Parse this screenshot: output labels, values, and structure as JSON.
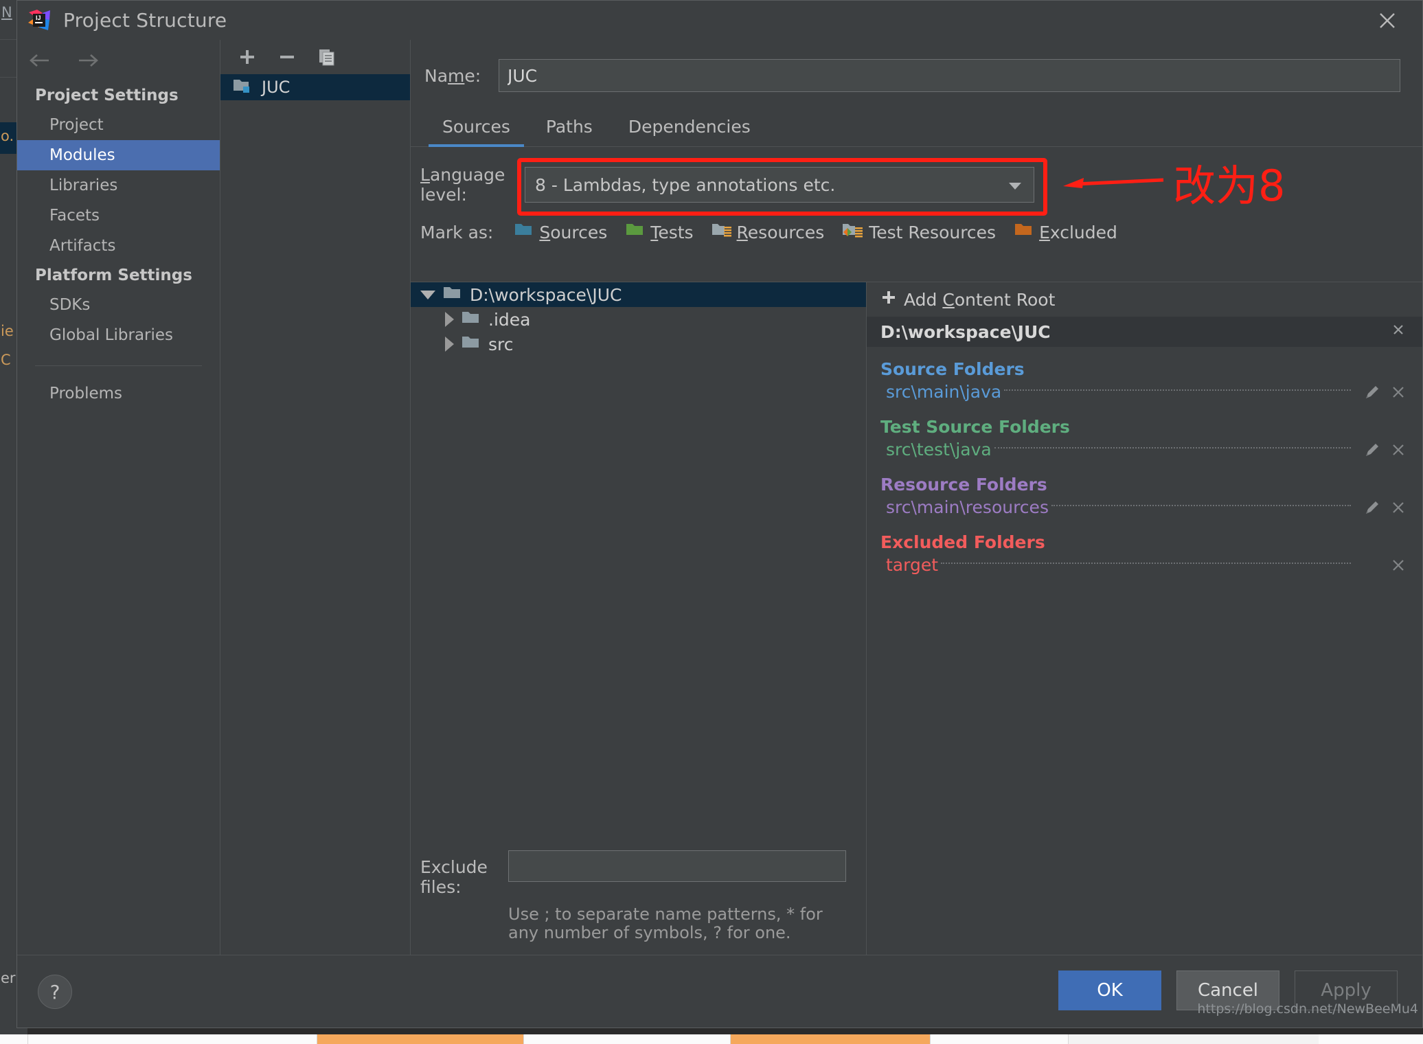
{
  "window": {
    "title": "Project Structure",
    "logo_icon": "intellij-idea-logo-icon",
    "close_icon": "close-icon"
  },
  "background": {
    "left_fragments": [
      "N",
      "o.",
      "ie",
      "C",
      "er"
    ],
    "watermark": "https://blog.csdn.net/NewBeeMu4"
  },
  "nav": {
    "back_icon": "arrow-left-icon",
    "forward_icon": "arrow-right-icon",
    "groups": [
      {
        "title": "Project Settings",
        "items": [
          {
            "label": "Project",
            "selected": false
          },
          {
            "label": "Modules",
            "selected": true
          },
          {
            "label": "Libraries",
            "selected": false
          },
          {
            "label": "Facets",
            "selected": false
          },
          {
            "label": "Artifacts",
            "selected": false
          }
        ]
      },
      {
        "title": "Platform Settings",
        "items": [
          {
            "label": "SDKs",
            "selected": false
          },
          {
            "label": "Global Libraries",
            "selected": false
          }
        ]
      }
    ],
    "footer_item": "Problems"
  },
  "module_list": {
    "toolbar": [
      {
        "icon": "plus-icon",
        "name": "add-module-button"
      },
      {
        "icon": "minus-icon",
        "name": "remove-module-button"
      },
      {
        "icon": "copy-icon",
        "name": "copy-module-button"
      }
    ],
    "modules": [
      {
        "label": "JUC",
        "icon": "module-folder-icon",
        "selected": true
      }
    ]
  },
  "main": {
    "name_label": "Name:",
    "name_label_mnemonic": "m",
    "name_value": "JUC",
    "name_placeholder": "",
    "tabs": [
      {
        "label": "Sources",
        "active": true
      },
      {
        "label": "Paths",
        "active": false
      },
      {
        "label": "Dependencies",
        "active": false
      }
    ],
    "language_level": {
      "label": "Language level:",
      "label_mnemonic": "L",
      "value": "8 - Lambdas, type annotations etc.",
      "dropdown_icon": "chevron-down-icon",
      "highlighted": true,
      "highlight_color": "#ff1f14"
    },
    "annotation": {
      "arrow_icon": "left-arrow-annotation",
      "text": "改为8",
      "color": "#ff1f14"
    },
    "mark_as": {
      "label": "Mark as:",
      "options": [
        {
          "label": "Sources",
          "mnemonic": "S",
          "icon": "sources-folder-icon",
          "color": "#3b7e9c"
        },
        {
          "label": "Tests",
          "mnemonic": "T",
          "icon": "tests-folder-icon",
          "color": "#5b9a3f"
        },
        {
          "label": "Resources",
          "mnemonic": "R",
          "icon": "resources-folder-icon",
          "color": "#9aa7ad"
        },
        {
          "label": "Test Resources",
          "mnemonic": "",
          "icon": "test-resources-folder-icon",
          "color": "#9aa7ad"
        },
        {
          "label": "Excluded",
          "mnemonic": "E",
          "icon": "excluded-folder-icon",
          "color": "#c4671e"
        }
      ]
    },
    "tree": [
      {
        "label": "D:\\workspace\\JUC",
        "depth": 0,
        "expanded": true,
        "selected": true,
        "icon": "folder-icon"
      },
      {
        "label": ".idea",
        "depth": 1,
        "expanded": false,
        "selected": false,
        "icon": "folder-icon"
      },
      {
        "label": "src",
        "depth": 1,
        "expanded": false,
        "selected": false,
        "icon": "folder-icon"
      }
    ],
    "exclude": {
      "label": "Exclude files:",
      "value": "",
      "placeholder": "",
      "hint_line1": "Use ; to separate name patterns, * for any number of",
      "hint_line2": "symbols, ? for one."
    }
  },
  "roots": {
    "add_label": "Add Content Root",
    "add_mnemonic": "C",
    "add_icon": "plus-icon",
    "root_path": "D:\\workspace\\JUC",
    "root_remove_icon": "close-icon",
    "groups": [
      {
        "title": "Source Folders",
        "color": "#5a9bd8",
        "folders": [
          {
            "name": "src\\main\\java",
            "edit_icon": "pencil-icon",
            "remove_icon": "close-icon",
            "has_edit": true
          }
        ]
      },
      {
        "title": "Test Source Folders",
        "color": "#5fae7f",
        "folders": [
          {
            "name": "src\\test\\java",
            "edit_icon": "pencil-icon",
            "remove_icon": "close-icon",
            "has_edit": true
          }
        ]
      },
      {
        "title": "Resource Folders",
        "color": "#9d7cc4",
        "folders": [
          {
            "name": "src\\main\\resources",
            "edit_icon": "pencil-icon",
            "remove_icon": "close-icon",
            "has_edit": true
          }
        ]
      },
      {
        "title": "Excluded Folders",
        "color": "#f25c5c",
        "folders": [
          {
            "name": "target",
            "edit_icon": "",
            "remove_icon": "close-icon",
            "has_edit": false
          }
        ]
      }
    ]
  },
  "footer": {
    "help_label": "?",
    "buttons": [
      {
        "label": "OK",
        "style": "ok"
      },
      {
        "label": "Cancel",
        "style": "cancel"
      },
      {
        "label": "Apply",
        "style": "apply"
      }
    ]
  }
}
